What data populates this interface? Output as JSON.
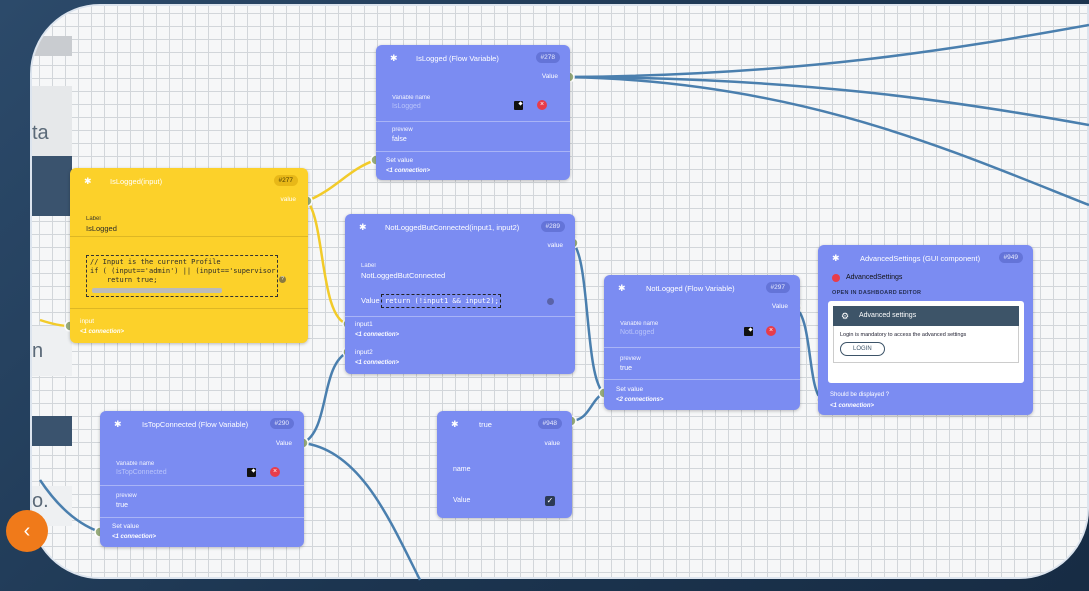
{
  "background_app": {
    "fragments": [
      "ta",
      "n",
      "o."
    ],
    "fab_icon": "chevron-left-icon"
  },
  "nodes": {
    "islogged_fv": {
      "title": "IsLogged (Flow Variable)",
      "id": "#278",
      "output_label": "Value",
      "variable_name_label": "Variable name",
      "variable_name_placeholder": "IsLogged",
      "preview_label": "preview",
      "preview_value": "false",
      "input_label": "Set value",
      "input_connections": "<1 connection>"
    },
    "islogged_input": {
      "title": "IsLogged(input)",
      "id": "#277",
      "output_label": "value",
      "label_label": "Label",
      "label_value": "IsLogged",
      "code": "// Input is the current Profile\nif ( (input=='admin') || (input=='supervisor\n    return true;",
      "input_label": "input",
      "input_connections": "<1 connection>"
    },
    "notloggedbutconnected": {
      "title": "NotLoggedButConnected(input1, input2)",
      "id": "#289",
      "output_label": "value",
      "label_label": "Label",
      "label_value": "NotLoggedButConnected",
      "value_label": "Value",
      "code": "return (!input1 && input2);",
      "input1_label": "input1",
      "input1_connections": "<1 connection>",
      "input2_label": "input2",
      "input2_connections": "<1 connection>"
    },
    "notlogged_fv": {
      "title": "NotLogged (Flow Variable)",
      "id": "#297",
      "output_label": "Value",
      "variable_name_label": "Variable name",
      "variable_name_placeholder": "NotLogged",
      "preview_label": "preview",
      "preview_value": "true",
      "input_label": "Set value",
      "input_connections": "<2 connections>"
    },
    "advancedsettings": {
      "title": "AdvancedSettings (GUI component)",
      "id": "#949",
      "component_name": "AdvancedSettings",
      "open_editor": "OPEN IN DASHBOARD EDITOR",
      "card_title": "Advanced settings",
      "card_message": "Login is mandatory to access the advanced settings",
      "login_button": "LOGIN",
      "input_label": "Should be displayed ?",
      "input_connections": "<1 connection>"
    },
    "istopconnected_fv": {
      "title": "IsTopConnected (Flow Variable)",
      "id": "#290",
      "output_label": "Value",
      "variable_name_label": "Variable name",
      "variable_name_placeholder": "IsTopConnected",
      "preview_label": "preview",
      "preview_value": "true",
      "input_label": "Set value",
      "input_connections": "<1 connection>"
    },
    "true_node": {
      "title": "true",
      "id": "#948",
      "output_label": "value",
      "name_label": "name",
      "value_label": "Value"
    }
  },
  "colors": {
    "node_blue": "#7b8cf2",
    "node_yellow": "#fcd12a",
    "wire_blue": "#4a7fae",
    "wire_yellow": "#f2cb2a",
    "port_green": "#9aae7e"
  }
}
